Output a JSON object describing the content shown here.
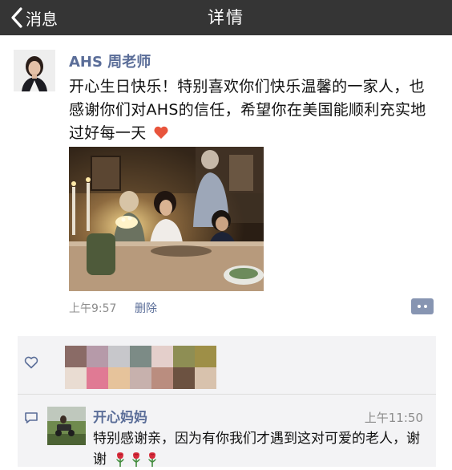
{
  "nav": {
    "back_label": "消息",
    "title": "详情"
  },
  "post": {
    "author": "AHS 周老师",
    "text": "开心生日快乐！特别喜欢你们快乐温馨的一家人，也感谢你们对AHS的信任，希望你在美国能顺利充实地过好每一天",
    "emoji": "heart",
    "time": "上午9:57",
    "delete_label": "删除"
  },
  "likes": {
    "icon": "heart-outline-icon",
    "blurred_colors": [
      "#8a6b66",
      "#b69aa9",
      "#c7c7cb",
      "#7c8b86",
      "#e4cfcb",
      "#8e8e54",
      "#9e8f47",
      "#e9dcd2",
      "#e07a94",
      "#e6c39b",
      "#c7b1ad",
      "#ba8d7f",
      "#6c5241",
      "#d8c2ad"
    ]
  },
  "comment": {
    "author": "开心妈妈",
    "time": "上午11:50",
    "text": "特别感谢亲，因为有你我们才遇到这对可爱的老人，谢谢",
    "rose_count": 3
  },
  "colors": {
    "nav_bg": "#353535",
    "link_blue": "#5a6d98",
    "panel_bg": "#f3f3f5",
    "more_button": "#8795b2"
  }
}
